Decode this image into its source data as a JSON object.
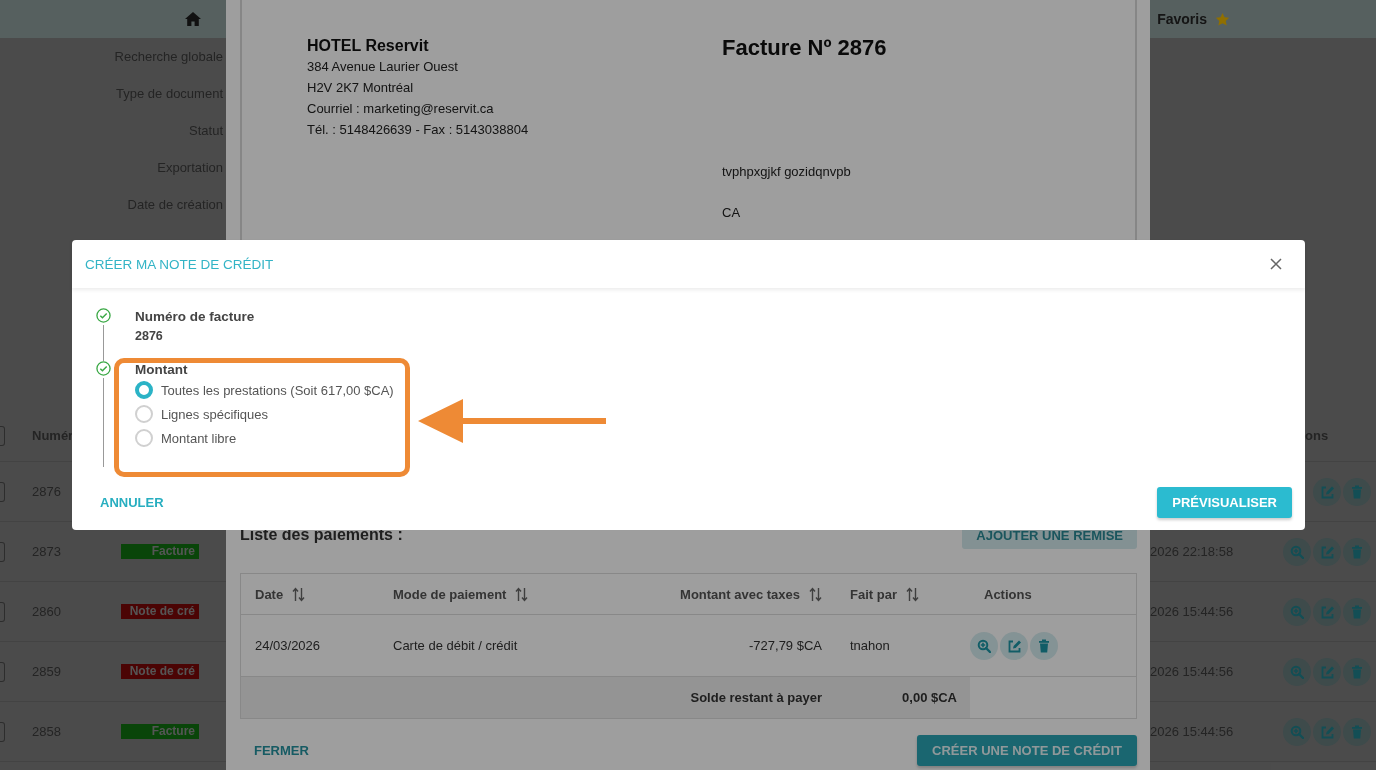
{
  "header": {
    "favorites_label": "Favoris"
  },
  "header_checkbox": {
    "checked": false
  },
  "filters": [
    "Recherche globale",
    "Type de document",
    "Statut",
    "Exportation",
    "Date de création"
  ],
  "documents_table": {
    "column_1": "Numér",
    "column_2": "ons",
    "rows": [
      {
        "number": "2876",
        "checked": false
      },
      {
        "number": "2873",
        "checked": false,
        "badge": {
          "label": "Facture",
          "kind": "invoice"
        },
        "date": "2026 22:18:58"
      },
      {
        "number": "2860",
        "checked": false,
        "badge": {
          "label": "Note de cré",
          "kind": "credit_note"
        },
        "date": "2026 15:44:56"
      },
      {
        "number": "2859",
        "checked": false,
        "badge": {
          "label": "Note de cré",
          "kind": "credit_note"
        },
        "date": "2026 15:44:56"
      },
      {
        "number": "2858",
        "checked": false,
        "badge": {
          "label": "Facture",
          "kind": "invoice"
        },
        "date": "2026 15:44:56"
      }
    ]
  },
  "invoice_modal": {
    "sender": {
      "name": "HOTEL Reservit",
      "lines": [
        "384 Avenue Laurier Ouest",
        "H2V 2K7 Montréal",
        "Courriel : marketing@reservit.ca",
        "Tél. : 5148426639 - Fax : 5143038804"
      ]
    },
    "title": "Facture Nº 2876",
    "recipient_lines": [
      "tvphpxgjkf gozidqnvpb",
      "CA"
    ],
    "payments": {
      "title": "Liste des paiements :",
      "add_button": "AJOUTER UNE REMISE",
      "columns": [
        {
          "label": "Date",
          "sortable": true
        },
        {
          "label": "Mode de paiement",
          "sortable": true
        },
        {
          "label": "Montant avec taxes",
          "sortable": true
        },
        {
          "label": "Fait par",
          "sortable": true
        },
        {
          "label": "Actions",
          "sortable": false
        }
      ],
      "rows": [
        {
          "cells": [
            "24/03/2026",
            "Carte de débit / crédit",
            "-727,79 $CA",
            "tnahon"
          ]
        }
      ],
      "balance_label": "Solde restant à payer",
      "balance_value": "0,00 $CA"
    },
    "close_button": "FERMER",
    "create_button": "CRÉER UNE NOTE DE CRÉDIT"
  },
  "dialog": {
    "title": "CRÉER MA NOTE DE CRÉDIT",
    "steps": [
      {
        "title": "Numéro de facture",
        "value": "2876",
        "done": true
      },
      {
        "title": "Montant",
        "done": true,
        "options": [
          {
            "label": "Toutes les prestations (Soit 617,00 $CA)",
            "selected": true
          },
          {
            "label": "Lignes spécifiques",
            "selected": false
          },
          {
            "label": "Montant libre",
            "selected": false
          }
        ]
      }
    ],
    "cancel_button": "ANNULER",
    "preview_button": "PRÉVISUALISER"
  },
  "annotation": {
    "highlight_box": true,
    "arrow": true
  }
}
